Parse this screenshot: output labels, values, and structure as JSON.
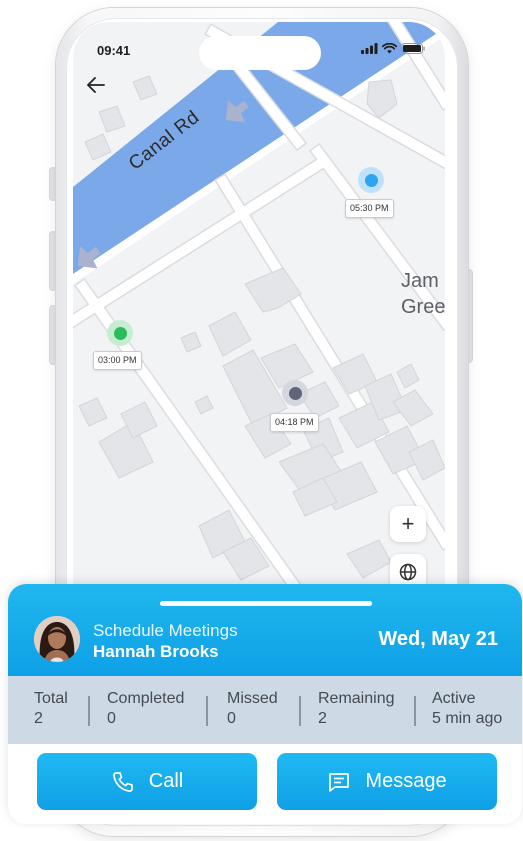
{
  "status_bar": {
    "time": "09:41"
  },
  "map": {
    "street_name": "Canal Rd",
    "place_label_line1": "Jam",
    "place_label_line2": "Gree",
    "pins": [
      {
        "time": "05:30 PM",
        "color": "#2fa4f0",
        "halo": "#bfe2fa"
      },
      {
        "time": "03:00 PM",
        "color": "#2bbd5a",
        "halo": "#c6ecd2"
      },
      {
        "time": "04:18 PM",
        "color": "#5f6478",
        "halo": "#d4d7de"
      }
    ],
    "zoom_in_label": "+"
  },
  "card": {
    "meeting_title": "Schedule Meetings",
    "person_name": "Hannah Brooks",
    "date": "Wed, May 21",
    "stats": [
      {
        "label": "Total",
        "value": "2"
      },
      {
        "label": "Completed",
        "value": "0"
      },
      {
        "label": "Missed",
        "value": "0"
      },
      {
        "label": "Remaining",
        "value": "2"
      },
      {
        "label": "Active",
        "value": "5 min ago"
      }
    ],
    "call_label": "Call",
    "message_label": "Message"
  },
  "colors": {
    "accent": "#16aaeb",
    "water": "#7aa8e8",
    "stats_bg": "#cdd9e4"
  }
}
